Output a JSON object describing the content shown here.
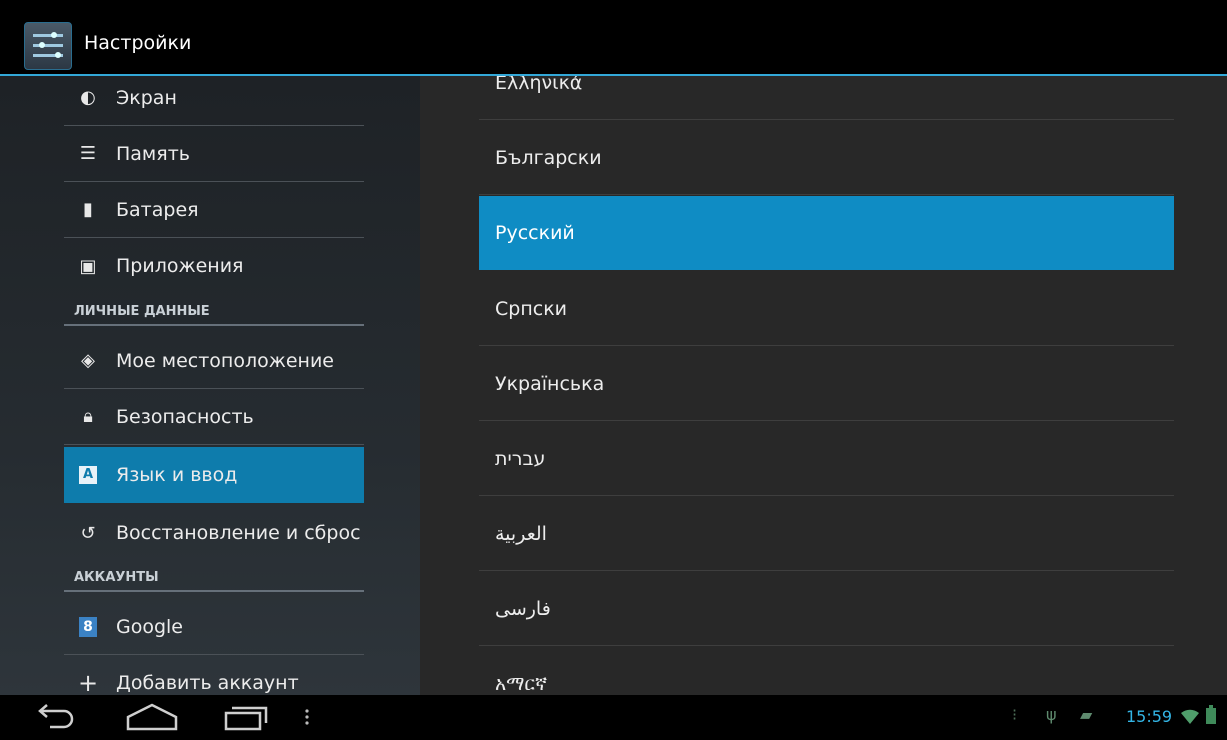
{
  "app": {
    "title": "Настройки",
    "icon": "settings-sliders-icon"
  },
  "left_panel": {
    "items": [
      {
        "label": "Экран",
        "icon": "display-icon"
      },
      {
        "label": "Память",
        "icon": "storage-icon"
      },
      {
        "label": "Батарея",
        "icon": "battery-icon"
      },
      {
        "label": "Приложения",
        "icon": "apps-icon"
      }
    ],
    "header_personal": "ЛИЧНЫЕ ДАННЫЕ",
    "personal_items": [
      {
        "label": "Мое местоположение",
        "icon": "location-icon"
      },
      {
        "label": "Безопасность",
        "icon": "lock-icon"
      },
      {
        "label": "Язык и ввод",
        "icon": "language-icon",
        "selected": true
      },
      {
        "label": "Восстановление и сброс",
        "icon": "restore-icon"
      }
    ],
    "header_accounts": "АККАУНТЫ",
    "account_items": [
      {
        "label": "Google",
        "icon": "google-icon"
      },
      {
        "label": "Добавить аккаунт",
        "icon": "add-icon"
      }
    ]
  },
  "language_list": {
    "items": [
      {
        "label": "Ελληνικά"
      },
      {
        "label": "Български"
      },
      {
        "label": "Русский",
        "selected": true
      },
      {
        "label": "Српски"
      },
      {
        "label": "Українська"
      },
      {
        "label": "עברית"
      },
      {
        "label": "العربية"
      },
      {
        "label": "فارسی"
      },
      {
        "label": "አማርኛ"
      }
    ]
  },
  "status_bar": {
    "time": "15:59"
  },
  "colors": {
    "accent": "#33a8d8",
    "selected_left": "#0e7cac",
    "selected_right": "#0f8cc4"
  }
}
